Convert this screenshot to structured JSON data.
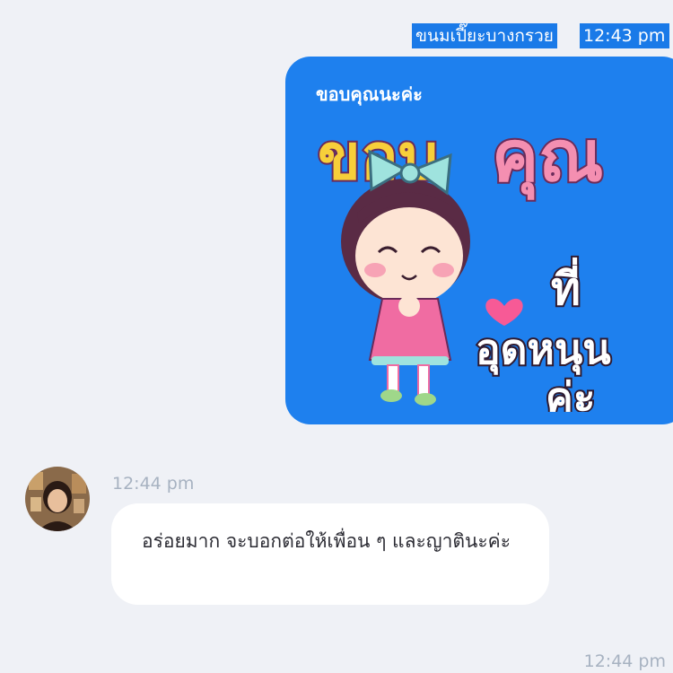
{
  "header": {
    "sender_name": "ขนมเปี๊ยะบางกรวย",
    "time": "12:43 pm"
  },
  "sticker_message": {
    "caption": "ขอบคุณนะค่ะ",
    "art_text": [
      "ขอบ",
      "คุณ",
      "ที่",
      "อุดหนุน",
      "ค่ะ"
    ],
    "bubble_color": "#1e80ee"
  },
  "incoming_message": {
    "time": "12:44 pm",
    "text": "อร่อยมาก จะบอกต่อให้เพื่อน ๆ และญาตินะค่ะ",
    "avatar_icon": "user-avatar"
  },
  "outgoing_footer": {
    "time": "12:44 pm"
  },
  "colors": {
    "background": "#eff1f6",
    "accent_blue": "#1a7ae8",
    "timestamp_gray": "#a7b2c1"
  }
}
